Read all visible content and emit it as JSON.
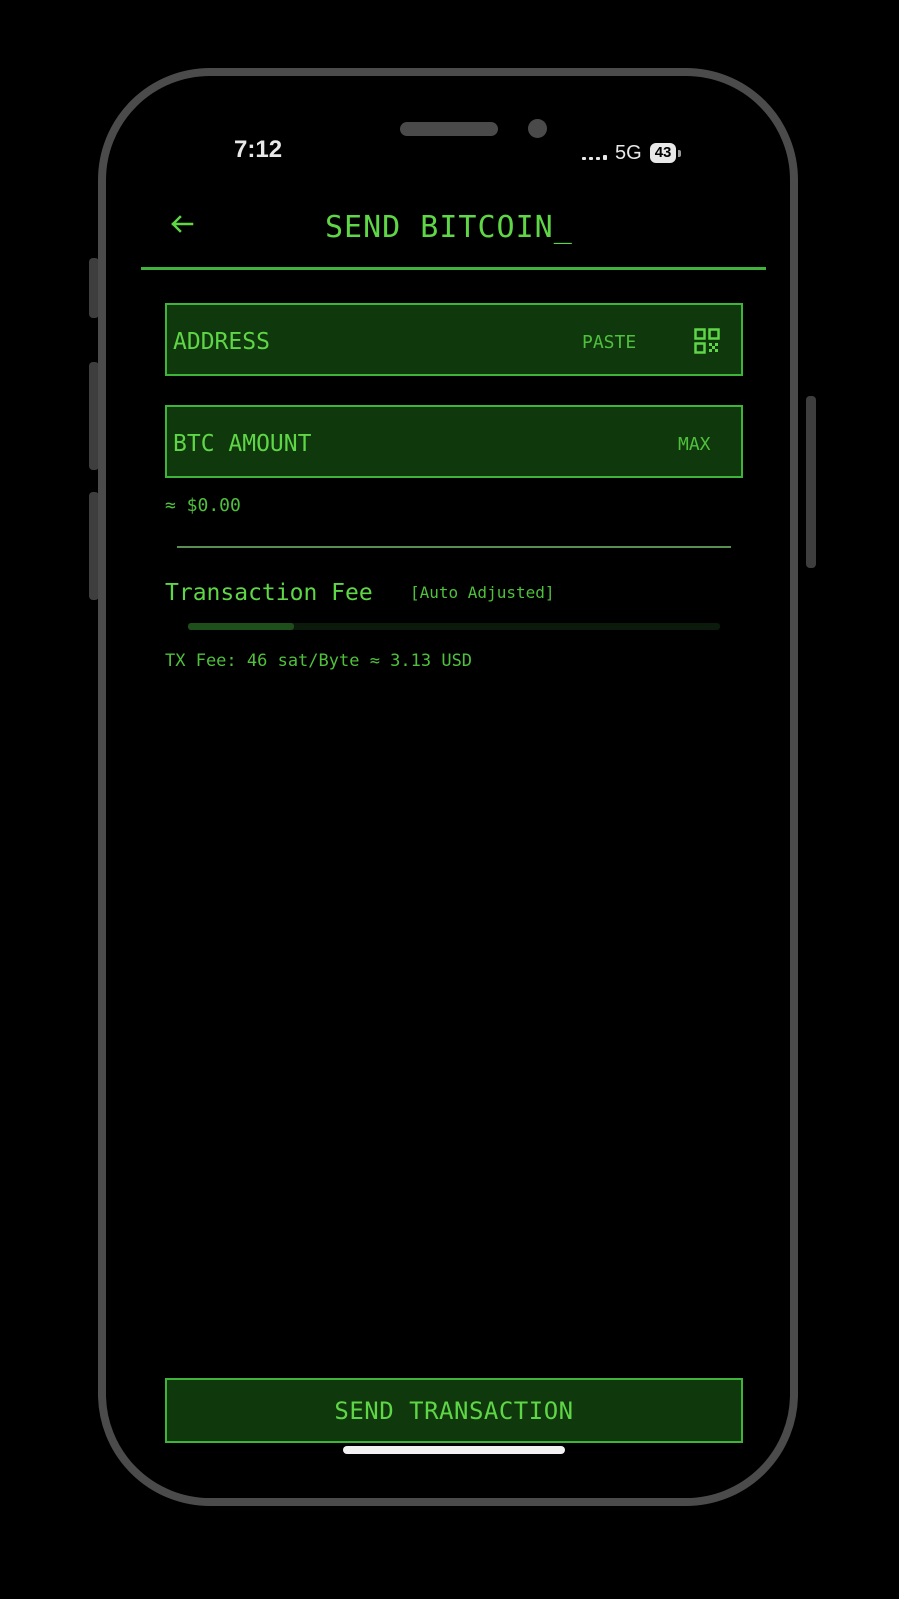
{
  "status_bar": {
    "time": "7:12",
    "network": "5G",
    "battery": "43"
  },
  "header": {
    "title": "SEND BITCOIN_",
    "back_icon": "arrow-left-icon"
  },
  "address_field": {
    "placeholder": "ADDRESS",
    "paste_label": "PASTE",
    "qr_icon": "qr-code-icon"
  },
  "amount_field": {
    "placeholder": "BTC AMOUNT",
    "max_label": "MAX",
    "fiat_estimate": "≈ $0.00"
  },
  "fee": {
    "title": "Transaction Fee",
    "mode": "[Auto Adjusted]",
    "slider_level": 0.2,
    "detail": "TX Fee: 46 sat/Byte ≈ 3.13 USD"
  },
  "send_button": {
    "label": "SEND TRANSACTION"
  },
  "colors": {
    "accent": "#5fd646",
    "border": "#3fb33a",
    "field_bg": "#0f380c",
    "background": "#000000"
  }
}
